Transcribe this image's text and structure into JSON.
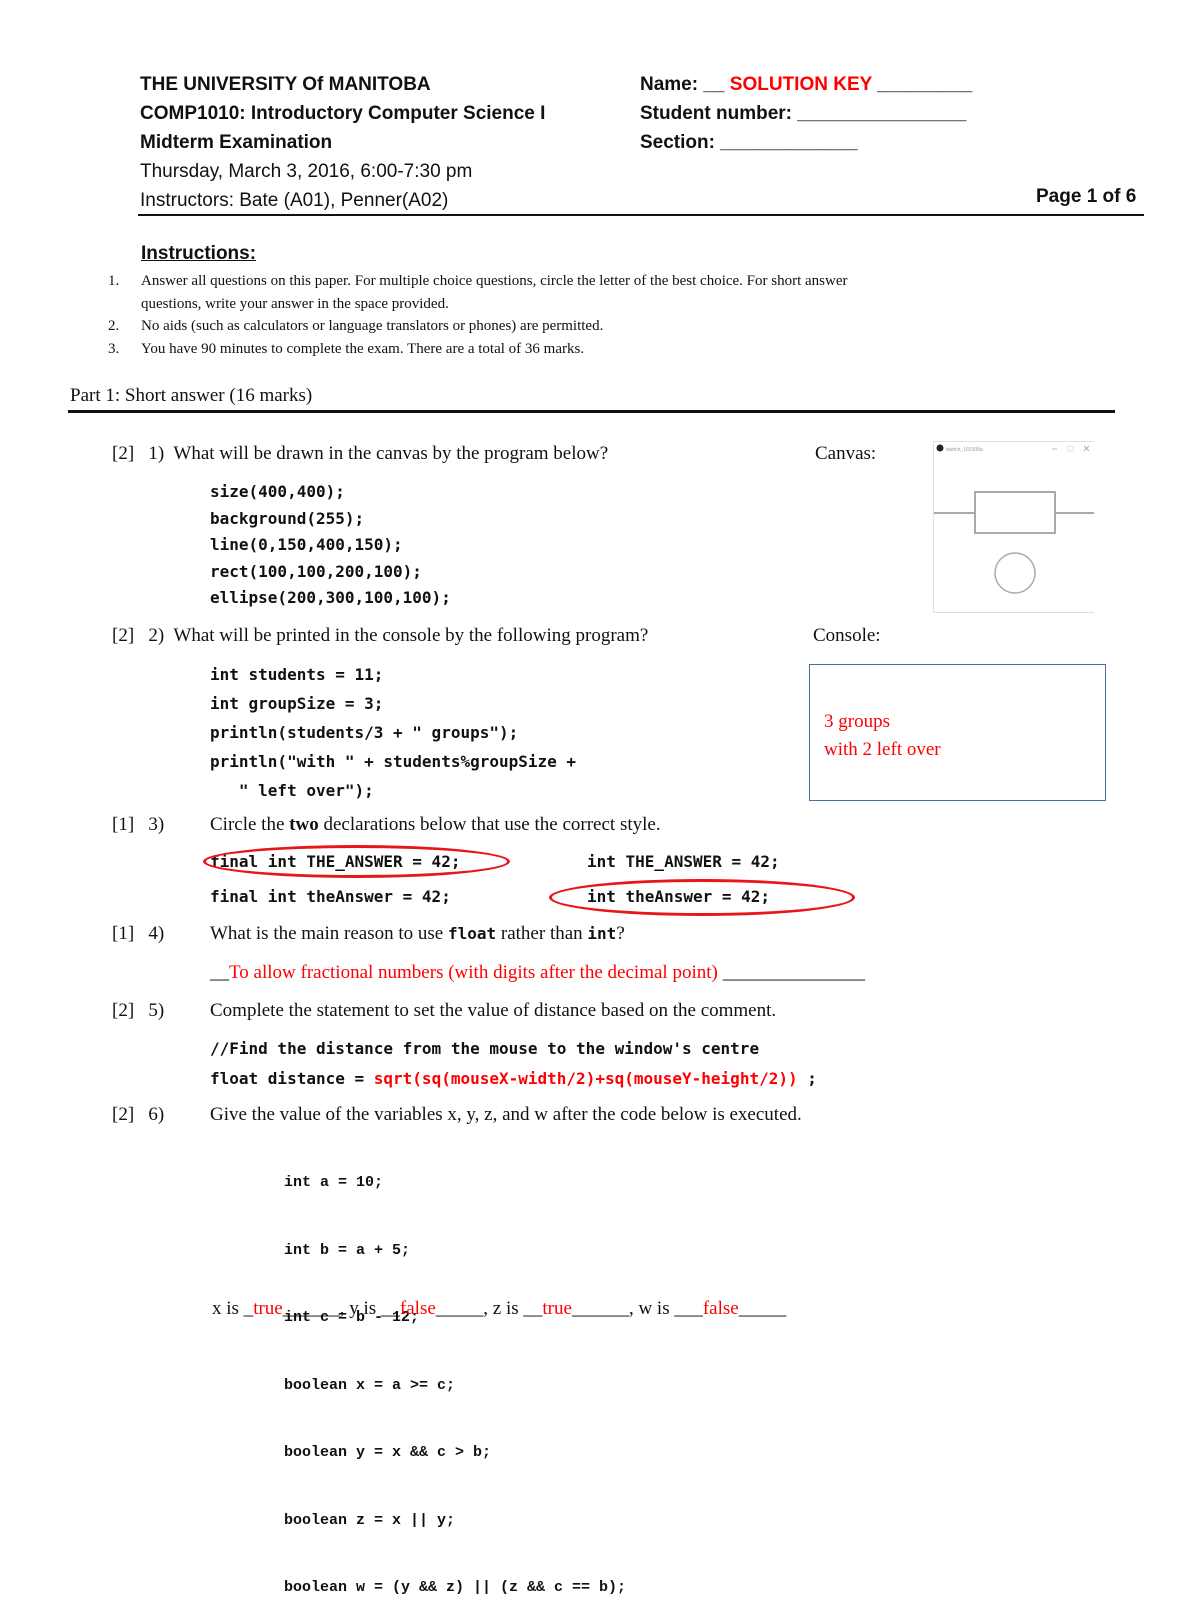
{
  "header": {
    "university": "THE UNIVERSITY Of MANITOBA",
    "course": "COMP1010: Introductory Computer Science I",
    "exam": "Midterm Examination",
    "date": "Thursday, March 3, 2016, 6:00-7:30 pm",
    "instructors": "Instructors: Bate (A01), Penner(A02)",
    "name_label": "Name: __ ",
    "name_value": "SOLUTION KEY",
    "name_suffix": " _________",
    "student_number": "Student number: ________________",
    "section": "Section: _____________",
    "page": "Page 1 of 6"
  },
  "instructions": {
    "title": "Instructions:",
    "items": [
      {
        "num": "1.",
        "line1": "Answer all questions on this paper. For multiple choice questions, circle the letter of the best choice. For short answer",
        "line2": "questions, write your answer in the space provided."
      },
      {
        "num": "2.",
        "line1": "No aids (such as calculators or language translators or phones) are permitted."
      },
      {
        "num": "3.",
        "line1": "You have 90 minutes to complete the exam. There are a total of 36 marks."
      }
    ]
  },
  "part1": {
    "title": "Part 1: Short answer (16 marks)",
    "q1": {
      "marks": "[2]",
      "num": "1)",
      "text": "What will be drawn in the canvas by the program below?",
      "side_label": "Canvas:",
      "code": [
        "size(400,400);",
        "background(255);",
        "line(0,150,400,150);",
        "rect(100,100,200,100);",
        "ellipse(200,300,100,100);"
      ],
      "canvas_title": "sketch_160108a"
    },
    "q2": {
      "marks": "[2]",
      "num": "2)",
      "text": "What will be printed in the console by the following program?",
      "side_label": "Console:",
      "code": [
        "int students = 11;",
        "int groupSize = 3;",
        "println(students/3 + \" groups\");",
        "println(\"with \" + students%groupSize +",
        "   \" left over\");"
      ],
      "answer": [
        "3 groups",
        "with 2 left over"
      ]
    },
    "q3": {
      "marks": "[1]",
      "num": "3)",
      "text_a": "Circle the ",
      "text_bold": "two",
      "text_b": " declarations below that use the correct style.",
      "options": [
        "final int THE_ANSWER = 42;",
        "int THE_ANSWER = 42;",
        "final int theAnswer = 42;",
        "int theAnswer = 42;"
      ]
    },
    "q4": {
      "marks": "[1]",
      "num": "4)",
      "text_a": "What is the main reason to use ",
      "code_a": "float",
      "text_b": " rather than ",
      "code_b": "int",
      "text_c": "?",
      "answer_prefix": "__",
      "answer": "To allow fractional numbers (with digits after the decimal point)",
      "answer_suffix": " _______________"
    },
    "q5": {
      "marks": "[2]",
      "num": "5)",
      "text": "Complete the statement to set the value of distance based on the comment.",
      "comment": "//Find the distance from the mouse to the window's centre",
      "stmt_prefix": "float distance = ",
      "answer": "sqrt(sq(mouseX-width/2)+sq(mouseY-height/2))",
      "stmt_suffix": " ;"
    },
    "q6": {
      "marks": "[2]",
      "num": "6)",
      "text": "Give the value of the variables x, y, z, and w after the code below is executed.",
      "code": [
        "int a = 10;",
        "int b = a + 5;",
        "int c = b - 12;",
        "boolean x = a >= c;",
        "boolean y = x && c > b;",
        "boolean z = x || y;",
        "boolean w = (y && z) || (z && c == b);"
      ],
      "answers": {
        "x_label": "x is _",
        "x": "true",
        "x_tail": "______, ",
        "y_label": "y is __",
        "y": "false",
        "y_tail": "_____, ",
        "z_label": "z is __",
        "z": "true",
        "z_tail": "______, ",
        "w_label": "w is ___",
        "w": "false",
        "w_tail": "_____"
      }
    }
  }
}
